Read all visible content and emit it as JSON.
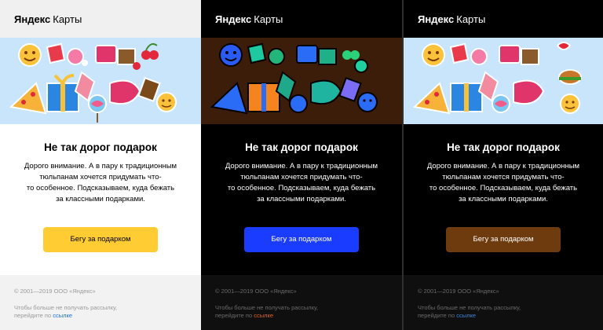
{
  "brand": {
    "bold": "Яндекс",
    "regular": "Карты"
  },
  "email": {
    "title": "Не так дорог подарок",
    "desc_lines": [
      "Дорого внимание. А в пару к традиционным",
      "тюльпанам хочется придумать что-",
      "то особенное. Подсказываем, куда бежать",
      "за классными подарками."
    ],
    "button_label": "Бегу за подарком",
    "footer_copy": "© 2001—2019 ООО «Яндекс»",
    "footer_unsub_line1": "Чтобы больше не получать рассылку,",
    "footer_unsub_prefix": "перейдите по",
    "footer_unsub_link": "ссылке"
  },
  "themes": {
    "light": {
      "banner_bg": "#c9e5fb",
      "button": "#ffcc33",
      "link": "#1a6dd8"
    },
    "dark": {
      "banner_bg": "#3b1d0a",
      "button": "#1a3cff",
      "link": "#e0651b"
    },
    "classic": {
      "banner_bg": "#c9e5fb",
      "button": "#6e3b0e",
      "link": "#3b86d8"
    }
  }
}
